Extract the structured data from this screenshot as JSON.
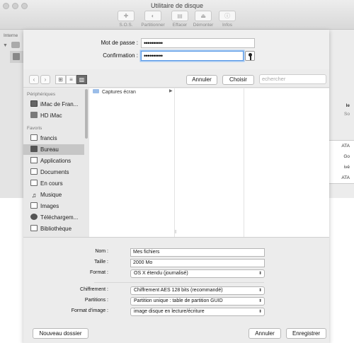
{
  "window": {
    "title": "Utilitaire de disque",
    "toolbar": [
      {
        "label": "S.O.S.",
        "icon": "stethoscope-icon"
      },
      {
        "label": "Partitionner",
        "icon": "pie-icon"
      },
      {
        "label": "Effacer",
        "icon": "erase-icon"
      },
      {
        "label": "Démonter",
        "icon": "eject-icon"
      },
      {
        "label": "Infos",
        "icon": "info-icon"
      }
    ],
    "sidebar_section": "Interne",
    "right_fragments": [
      "le",
      "So",
      "ATA",
      "Go",
      "ivé",
      "ATA"
    ]
  },
  "password": {
    "label": "Mot de passe :",
    "value": "••••••••••",
    "confirm_label": "Confirmation :",
    "confirm_value": "••••••••••"
  },
  "browser": {
    "cancel": "Annuler",
    "choose": "Choisir",
    "search_placeholder": "echercher"
  },
  "sidebar": {
    "devices_header": "Périphériques",
    "devices": [
      {
        "label": "iMac de Fran...",
        "icon": "imac-icon"
      },
      {
        "label": "HD iMac",
        "icon": "hard-drive-icon"
      }
    ],
    "favorites_header": "Favoris",
    "favorites": [
      {
        "label": "francis",
        "icon": "home-icon"
      },
      {
        "label": "Bureau",
        "icon": "desktop-icon",
        "selected": true
      },
      {
        "label": "Applications",
        "icon": "applications-icon"
      },
      {
        "label": "Documents",
        "icon": "documents-icon"
      },
      {
        "label": "En cours",
        "icon": "folder-icon"
      },
      {
        "label": "Musique",
        "icon": "music-icon"
      },
      {
        "label": "Images",
        "icon": "pictures-icon"
      },
      {
        "label": "Téléchargem...",
        "icon": "download-icon"
      },
      {
        "label": "Bibliothèque",
        "icon": "library-icon"
      }
    ]
  },
  "columns": {
    "item": "Captures écran"
  },
  "form": {
    "name_label": "Nom :",
    "name_value": "Mes fichiers",
    "size_label": "Taille :",
    "size_value": "2000 Mo",
    "format_label": "Format :",
    "format_value": "OS X étendu (journalisé)",
    "encryption_label": "Chiffrement :",
    "encryption_value": "Chiffrement AES 128 bits (recommandé)",
    "partitions_label": "Partitions :",
    "partitions_value": "Partition unique : table de partition GUID",
    "image_format_label": "Format d'image :",
    "image_format_value": "image disque en lecture/écriture"
  },
  "footer": {
    "new_folder": "Nouveau dossier",
    "cancel": "Annuler",
    "save": "Enregistrer"
  }
}
